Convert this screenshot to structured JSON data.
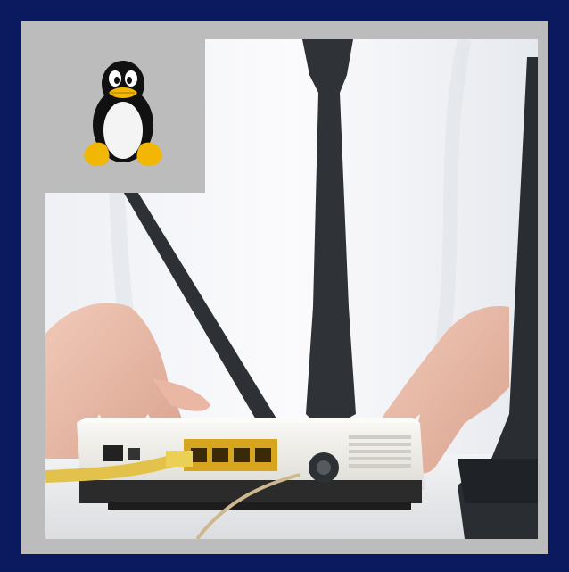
{
  "image": {
    "subject": "office-router-setup",
    "logo": "tux-penguin-icon",
    "colors": {
      "outer_border": "#0b1a5e",
      "inner_frame": "#bcbcbc",
      "router_body": "#eeeeea",
      "router_base": "#2b2b2b",
      "ports": "#d7a520",
      "cable": "#e2c24a",
      "tie": "#2f3236",
      "shirt": "#f4f5f8",
      "laptop": "#2a2d31",
      "skin": "#e7b9a6"
    }
  }
}
